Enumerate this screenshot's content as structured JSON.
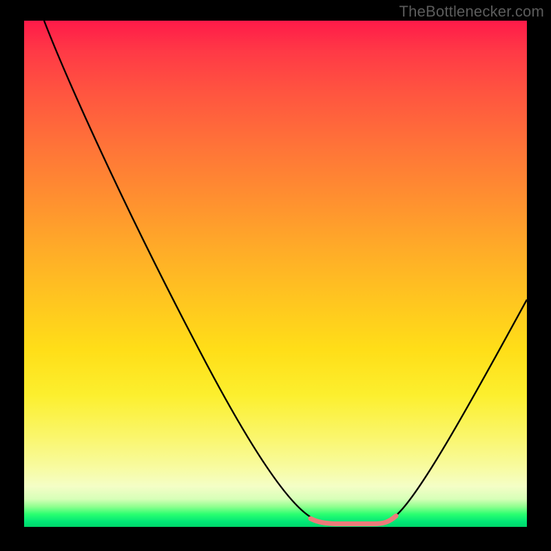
{
  "watermark": "TheBottlenecker.com",
  "chart_data": {
    "type": "line",
    "title": "",
    "xlabel": "",
    "ylabel": "",
    "xlim": [
      0,
      100
    ],
    "ylim": [
      0,
      100
    ],
    "gradient_stops": [
      {
        "pos": 0,
        "color": "#ff1a49"
      },
      {
        "pos": 25,
        "color": "#ff7438"
      },
      {
        "pos": 55,
        "color": "#ffc520"
      },
      {
        "pos": 82,
        "color": "#faf66a"
      },
      {
        "pos": 94,
        "color": "#d7ffb8"
      },
      {
        "pos": 100,
        "color": "#00d66a"
      }
    ],
    "series": [
      {
        "name": "bottleneck-curve",
        "color": "#000000",
        "points": [
          {
            "x": 4,
            "y": 100
          },
          {
            "x": 12,
            "y": 85
          },
          {
            "x": 20,
            "y": 70
          },
          {
            "x": 28,
            "y": 55
          },
          {
            "x": 36,
            "y": 40
          },
          {
            "x": 44,
            "y": 25
          },
          {
            "x": 52,
            "y": 10
          },
          {
            "x": 57,
            "y": 3
          },
          {
            "x": 60,
            "y": 0.7
          },
          {
            "x": 65,
            "y": 0.6
          },
          {
            "x": 70,
            "y": 0.6
          },
          {
            "x": 73,
            "y": 1.8
          },
          {
            "x": 78,
            "y": 8
          },
          {
            "x": 85,
            "y": 20
          },
          {
            "x": 92,
            "y": 32
          },
          {
            "x": 100,
            "y": 45
          }
        ]
      },
      {
        "name": "optimal-range-marker",
        "color": "#ed7b7a",
        "points": [
          {
            "x": 58,
            "y": 1.2
          },
          {
            "x": 60,
            "y": 0.7
          },
          {
            "x": 65,
            "y": 0.6
          },
          {
            "x": 70,
            "y": 0.6
          },
          {
            "x": 73,
            "y": 1.8
          }
        ]
      }
    ]
  }
}
